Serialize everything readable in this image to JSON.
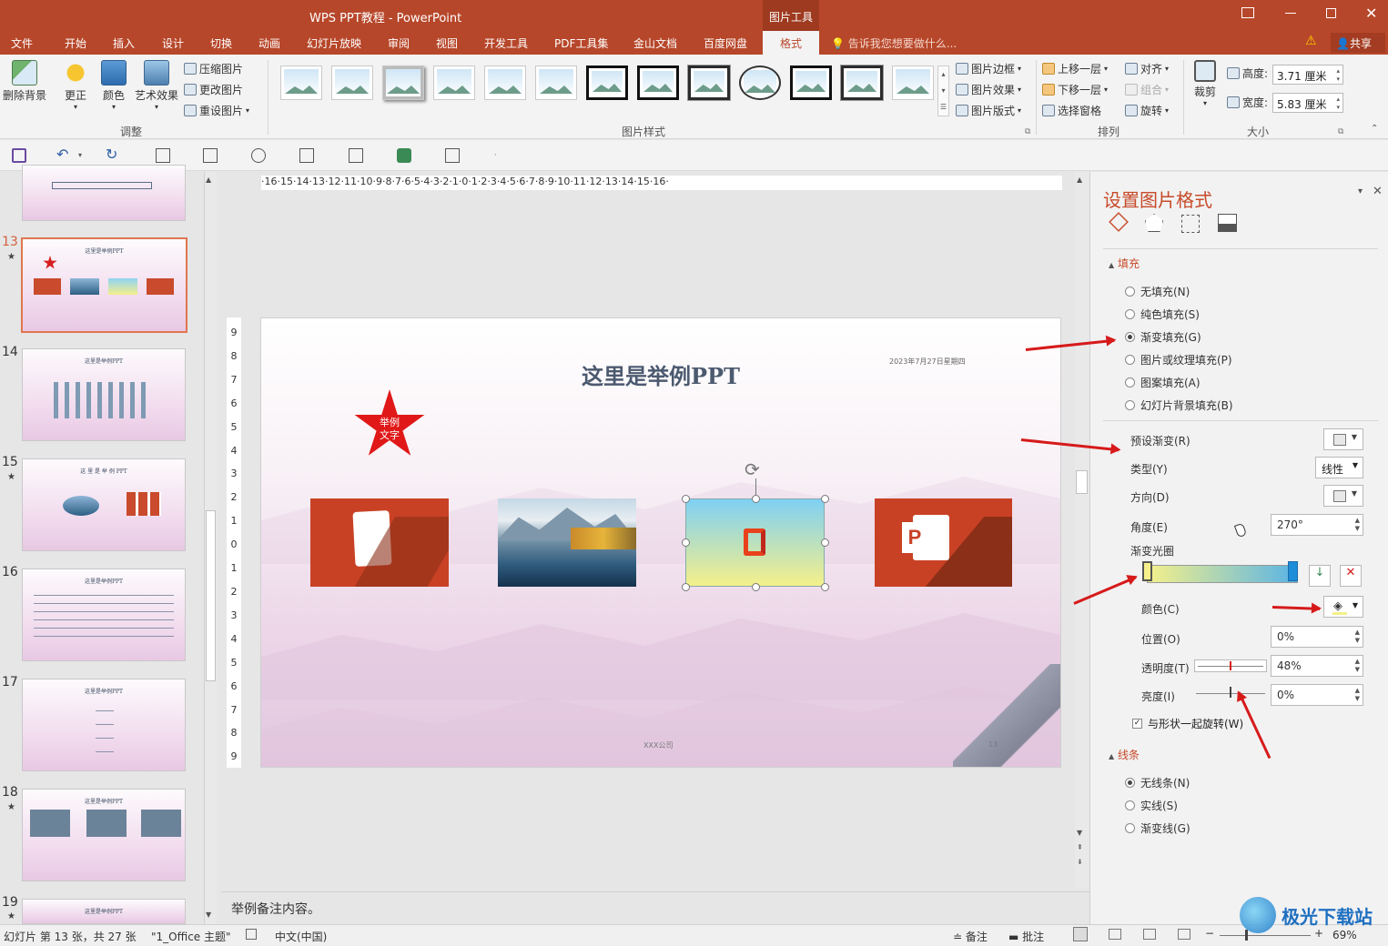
{
  "titlebar": {
    "title": "WPS PPT教程 - PowerPoint",
    "context_tab": "图片工具"
  },
  "menu": {
    "items": [
      "文件",
      "开始",
      "插入",
      "设计",
      "切换",
      "动画",
      "幻灯片放映",
      "审阅",
      "视图",
      "开发工具",
      "PDF工具集",
      "金山文档",
      "百度网盘",
      "格式"
    ],
    "active": "格式",
    "tell_me": "告诉我您想要做什么...",
    "share": "共享"
  },
  "ribbon": {
    "remove_bg": "删除背景",
    "correct": "更正",
    "color": "颜色",
    "artistic": "艺术效果",
    "compress": "压缩图片",
    "change": "更改图片",
    "reset": "重设图片",
    "group_adjust": "调整",
    "group_styles": "图片样式",
    "border": "图片边框",
    "effects": "图片效果",
    "layout": "图片版式",
    "bring_forward": "上移一层",
    "send_backward": "下移一层",
    "selection_pane": "选择窗格",
    "align": "对齐",
    "group": "组合",
    "rotate": "旋转",
    "group_arrange": "排列",
    "crop": "裁剪",
    "height_label": "高度:",
    "height_value": "3.71 厘米",
    "width_label": "宽度:",
    "width_value": "5.83 厘米",
    "group_size": "大小"
  },
  "ruler": {
    "h_ticks": "·16·15·14·13·12·11·10·9·8·7·6·5·4·3·2·1·0·1·2·3·4·5·6·7·8·9·10·11·12·13·14·15·16·",
    "v_ticks": [
      "9",
      "8",
      "7",
      "6",
      "5",
      "4",
      "3",
      "2",
      "1",
      "0",
      "1",
      "2",
      "3",
      "4",
      "5",
      "6",
      "7",
      "8",
      "9"
    ]
  },
  "slides": [
    {
      "num": "",
      "star": false,
      "title": ""
    },
    {
      "num": "13",
      "star": true,
      "title": "这里是举例PPT",
      "selected": true
    },
    {
      "num": "14",
      "star": false,
      "title": "这里是举例PPT"
    },
    {
      "num": "15",
      "star": true,
      "title": "这 里 是 举 例 PPT"
    },
    {
      "num": "16",
      "star": false,
      "title": "这里是举例PPT"
    },
    {
      "num": "17",
      "star": false,
      "title": "这里是举例PPT"
    },
    {
      "num": "18",
      "star": true,
      "title": "这里是举例PPT"
    },
    {
      "num": "19",
      "star": true,
      "title": "这里是举例PPT"
    }
  ],
  "slide": {
    "title": "这里是举例PPT",
    "date": "2023年7月27日星期四",
    "star_text": "举例\n文字",
    "company": "XXX公司",
    "page": "13"
  },
  "notes": "举例备注内容。",
  "panel": {
    "title": "设置图片格式",
    "fill_section": "填充",
    "fill_options": [
      "无填充(N)",
      "纯色填充(S)",
      "渐变填充(G)",
      "图片或纹理填充(P)",
      "图案填充(A)",
      "幻灯片背景填充(B)"
    ],
    "fill_selected": 2,
    "preset_gradient": "预设渐变(R)",
    "type_label": "类型(Y)",
    "type_value": "线性",
    "direction_label": "方向(D)",
    "angle_label": "角度(E)",
    "angle_value": "270°",
    "stops_label": "渐变光圈",
    "color_label": "颜色(C)",
    "position_label": "位置(O)",
    "position_value": "0%",
    "transparency_label": "透明度(T)",
    "transparency_value": "48%",
    "transparency_level": 0.48,
    "brightness_label": "亮度(I)",
    "brightness_value": "0%",
    "rotate_with_shape": "与形状一起旋转(W)",
    "line_section": "线条",
    "line_options": [
      "无线条(N)",
      "实线(S)",
      "渐变线(G)"
    ],
    "line_selected": 0
  },
  "status": {
    "slide_info": "幻灯片 第 13 张，共 27 张",
    "theme": "\"1_Office 主题\"",
    "language": "中文(中国)",
    "notes": "备注",
    "comments": "批注",
    "zoom": "69%",
    "watermark": "极光下载站"
  },
  "colors": {
    "accent": "#b7472a",
    "arrow": "#d61a1a",
    "gradient_start": "#f5f08a",
    "gradient_end": "#5ab4e6"
  }
}
